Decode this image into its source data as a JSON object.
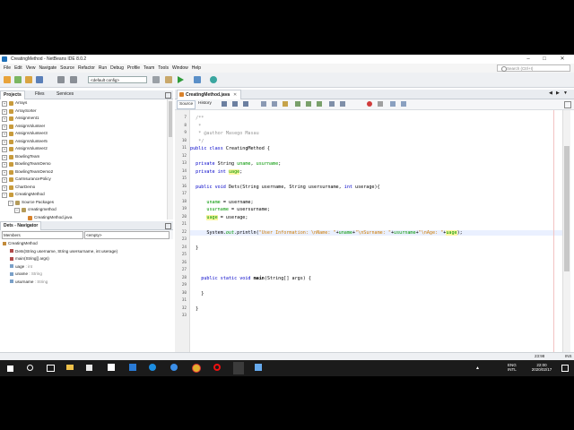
{
  "window": {
    "title": "CreatingMethod - NetBeans IDE 8.0.2"
  },
  "menu": [
    "File",
    "Edit",
    "View",
    "Navigate",
    "Source",
    "Refactor",
    "Run",
    "Debug",
    "Profile",
    "Team",
    "Tools",
    "Window",
    "Help"
  ],
  "search": {
    "placeholder": "Search (Ctrl+I)"
  },
  "toolbar": {
    "config_value": "<default config>"
  },
  "left_tabs": [
    "Projects",
    "Files",
    "Services"
  ],
  "projects": [
    {
      "label": "Arrays",
      "level": 0
    },
    {
      "label": "ArraySorter",
      "level": 0
    },
    {
      "label": "Assignment1",
      "level": 0
    },
    {
      "label": "AssignVolunteer",
      "level": 0
    },
    {
      "label": "AssignVolunteer3",
      "level": 0
    },
    {
      "label": "AssignVolunteer5",
      "level": 0
    },
    {
      "label": "AssignVolunteer2",
      "level": 0
    },
    {
      "label": "BowlingTeam",
      "level": 0
    },
    {
      "label": "BowlingTeamDemo",
      "level": 0
    },
    {
      "label": "BowlingTeamDemo2",
      "level": 0
    },
    {
      "label": "CarInsurancePolicy",
      "level": 0
    },
    {
      "label": "CharDemo",
      "level": 0
    },
    {
      "label": "CreatingMethod",
      "level": 0
    },
    {
      "label": "Source Packages",
      "level": 1
    },
    {
      "label": "creatingmethod",
      "level": 2
    },
    {
      "label": "CreatingMethod.java",
      "level": 3
    }
  ],
  "navigator": {
    "title": "Dets - Navigator",
    "filter_label": "Members",
    "filter_value": "<empty>",
    "items": [
      {
        "label": "CreatingMethod",
        "type": "",
        "level": 0
      },
      {
        "label": "Dets(String username, String usersurname, int userage)",
        "type": "",
        "level": 1
      },
      {
        "label": "main(String[] args)",
        "type": "",
        "level": 1
      },
      {
        "label": "uage",
        "type": " : int",
        "level": 1
      },
      {
        "label": "uname",
        "type": " : String",
        "level": 1
      },
      {
        "label": "usurname",
        "type": " : String",
        "level": 1
      }
    ]
  },
  "editor": {
    "tab_label": "CreatingMethod.java",
    "source_tab": "Source",
    "history_tab": "History",
    "line_numbers": [
      "7",
      "8",
      "9",
      "10",
      "11",
      "12",
      "13",
      "14",
      "15",
      "16",
      "17",
      "18",
      "19",
      "20",
      "21",
      "22",
      "23",
      "24",
      "25",
      "26",
      "27",
      "28",
      "29",
      "30",
      "31",
      "32",
      "33"
    ]
  },
  "status": {
    "position": "23:98",
    "mode": "INS"
  },
  "taskbar": {
    "lang1": "ENG",
    "lang2": "INTL",
    "time": "22:00",
    "date": "2020/02/17"
  },
  "colors": {
    "keyword": "#0000c8",
    "comment": "#969696",
    "field": "#009600",
    "string": "#ce7b00"
  }
}
